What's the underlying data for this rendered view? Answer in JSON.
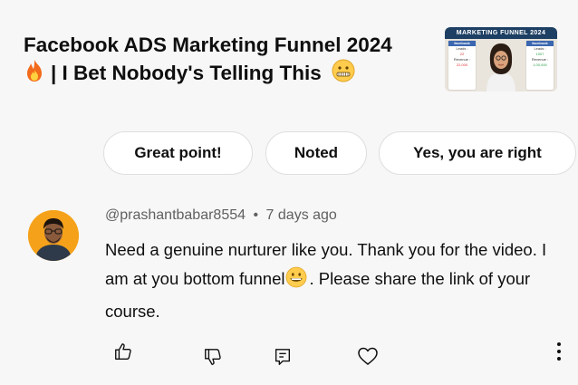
{
  "video": {
    "title_line1": "Facebook ADS Marketing Funnel 2024",
    "title_line2": "| I Bet Nobody's Telling This",
    "thumbnail": {
      "banner": "MARKETING FUNNEL 2024",
      "left_card": {
        "header": "facebook",
        "leads_label": "Leads :",
        "leads_value": "22",
        "revenue_label": "Revenue :",
        "revenue_value": "22,000"
      },
      "right_card": {
        "header": "facebook",
        "leads_label": "Leads :",
        "leads_value": "1007",
        "revenue_label": "Revenue :",
        "revenue_value": "1.00,000"
      }
    }
  },
  "quick_replies": [
    "Great point!",
    "Noted",
    "Yes, you are right"
  ],
  "comment": {
    "author": "@prashantbabar8554",
    "separator": "•",
    "time": "7 days ago",
    "text_part1": "Need a genuine nurturer like you. Thank you for the video. I am at you bottom funnel",
    "text_part2": ". Please share the link of your course."
  },
  "actions": {
    "icons": [
      "like-icon",
      "dislike-icon",
      "reply-icon",
      "heart-icon",
      "more-icon"
    ]
  },
  "colors": {
    "background": "#f7f7f7",
    "chip_border": "#dedede",
    "secondary_text": "#606060"
  }
}
